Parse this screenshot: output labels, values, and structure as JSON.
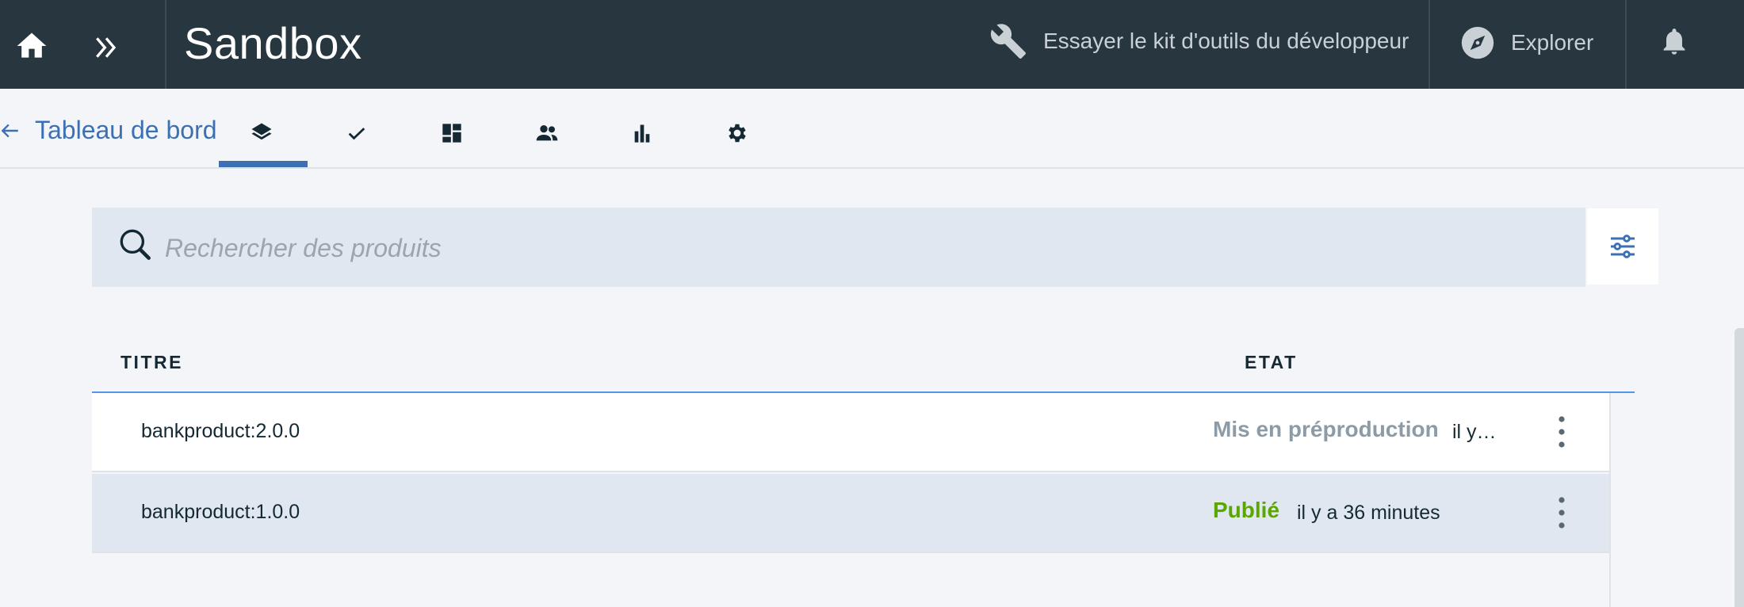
{
  "header": {
    "title": "Sandbox",
    "toolkit_label": "Essayer le kit d'outils du développeur",
    "explore_label": "Explorer"
  },
  "subnav": {
    "back_label": "Tableau de bord",
    "tabs": [
      {
        "icon": "layers-icon",
        "active": true
      },
      {
        "icon": "checkmark-icon",
        "active": false
      },
      {
        "icon": "grid-icon",
        "active": false
      },
      {
        "icon": "people-icon",
        "active": false
      },
      {
        "icon": "bar-chart-icon",
        "active": false
      },
      {
        "icon": "settings-icon",
        "active": false
      }
    ]
  },
  "search": {
    "placeholder": "Rechercher des produits",
    "value": ""
  },
  "table": {
    "columns": [
      "TITRE",
      "ETAT"
    ],
    "rows": [
      {
        "title": "bankproduct:2.0.0",
        "status": "Mis en préproduction",
        "status_color": "#8c9ba5",
        "time": "il y…"
      },
      {
        "title": "bankproduct:1.0.0",
        "status": "Publié",
        "status_color": "#5aa700",
        "time": "il y a 36 minutes"
      }
    ]
  },
  "colors": {
    "header_bg": "#27363f",
    "accent": "#3d70b2",
    "search_bg": "#e0e7f1",
    "selected_row_bg": "#e0e7f1"
  }
}
